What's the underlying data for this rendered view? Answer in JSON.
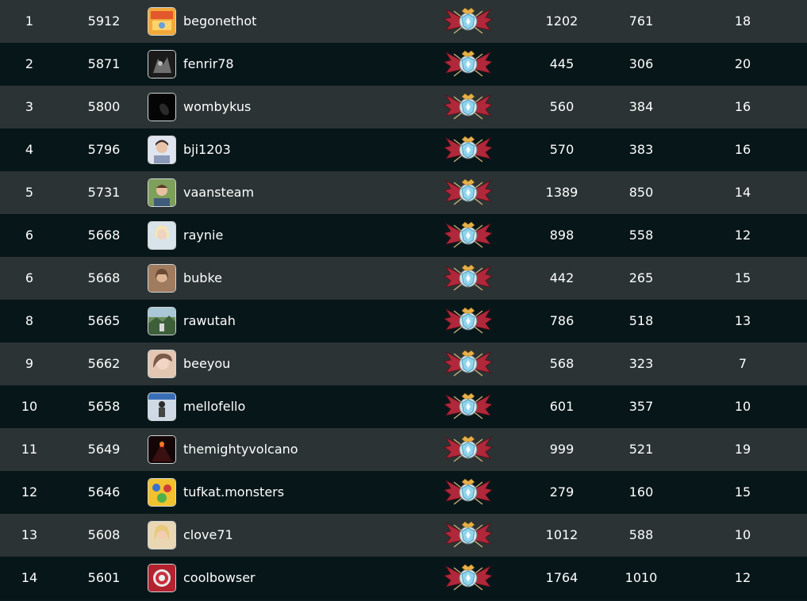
{
  "leaderboard": {
    "rank_badge_icon": "league-crest-icon",
    "rows": [
      {
        "rank": "1",
        "score": "5912",
        "username": "begonethot",
        "avatar_icon": "avatar-orange-art",
        "col_a": "1202",
        "col_b": "761",
        "col_c": "18"
      },
      {
        "rank": "2",
        "score": "5871",
        "username": "fenrir78",
        "avatar_icon": "avatar-dark-creature",
        "col_a": "445",
        "col_b": "306",
        "col_c": "20"
      },
      {
        "rank": "3",
        "score": "5800",
        "username": "wombykus",
        "avatar_icon": "avatar-black",
        "col_a": "560",
        "col_b": "384",
        "col_c": "16"
      },
      {
        "rank": "4",
        "score": "5796",
        "username": "bji1203",
        "avatar_icon": "avatar-person-light",
        "col_a": "570",
        "col_b": "383",
        "col_c": "16"
      },
      {
        "rank": "5",
        "score": "5731",
        "username": "vaansteam",
        "avatar_icon": "avatar-person-outdoor",
        "col_a": "1389",
        "col_b": "850",
        "col_c": "14"
      },
      {
        "rank": "6",
        "score": "5668",
        "username": "raynie",
        "avatar_icon": "avatar-person-blonde",
        "col_a": "898",
        "col_b": "558",
        "col_c": "12"
      },
      {
        "rank": "6",
        "score": "5668",
        "username": "bubke",
        "avatar_icon": "avatar-person-brown",
        "col_a": "442",
        "col_b": "265",
        "col_c": "15"
      },
      {
        "rank": "8",
        "score": "5665",
        "username": "rawutah",
        "avatar_icon": "avatar-landscape",
        "col_a": "786",
        "col_b": "518",
        "col_c": "13"
      },
      {
        "rank": "9",
        "score": "5662",
        "username": "beeyou",
        "avatar_icon": "avatar-person-selfie",
        "col_a": "568",
        "col_b": "323",
        "col_c": "7"
      },
      {
        "rank": "10",
        "score": "5658",
        "username": "mellofello",
        "avatar_icon": "avatar-figure-blue",
        "col_a": "601",
        "col_b": "357",
        "col_c": "10"
      },
      {
        "rank": "11",
        "score": "5649",
        "username": "themightyvolcano",
        "avatar_icon": "avatar-volcano",
        "col_a": "999",
        "col_b": "521",
        "col_c": "19"
      },
      {
        "rank": "12",
        "score": "5646",
        "username": "tufkat.monsters",
        "avatar_icon": "avatar-yellow-monsters",
        "col_a": "279",
        "col_b": "160",
        "col_c": "15"
      },
      {
        "rank": "13",
        "score": "5608",
        "username": "clove71",
        "avatar_icon": "avatar-person-blonde-2",
        "col_a": "1012",
        "col_b": "588",
        "col_c": "10"
      },
      {
        "rank": "14",
        "score": "5601",
        "username": "coolbowser",
        "avatar_icon": "avatar-red-emblem",
        "col_a": "1764",
        "col_b": "1010",
        "col_c": "12"
      }
    ]
  },
  "colors": {
    "row_light": "#2b3334",
    "row_dark": "#071619",
    "text": "#ffffff",
    "badge_wing": "#b0283a",
    "badge_shield": "#8fd3ec"
  }
}
